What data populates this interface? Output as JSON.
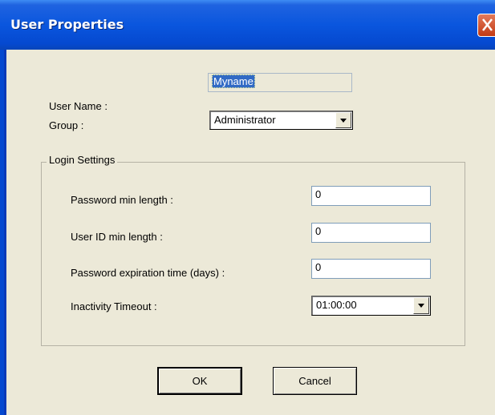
{
  "window": {
    "title": "User Properties"
  },
  "form": {
    "user_name_label": "User Name :",
    "user_name_value": "Myname",
    "group_label": "Group :",
    "group_value": "Administrator"
  },
  "login_settings": {
    "title": "Login Settings",
    "password_min_length_label": "Password min length :",
    "password_min_length_value": "0",
    "user_id_min_length_label": "User ID min length :",
    "user_id_min_length_value": "0",
    "password_expiration_label": "Password expiration time (days) :",
    "password_expiration_value": "0",
    "inactivity_timeout_label": "Inactivity Timeout :",
    "inactivity_timeout_value": "01:00:00"
  },
  "buttons": {
    "ok_label": "OK",
    "cancel_label": "Cancel"
  },
  "colors": {
    "titlebar": "#0a56de",
    "dialog_background": "#ece9d8",
    "selection": "#316ac5",
    "close_button": "#c23a14"
  }
}
